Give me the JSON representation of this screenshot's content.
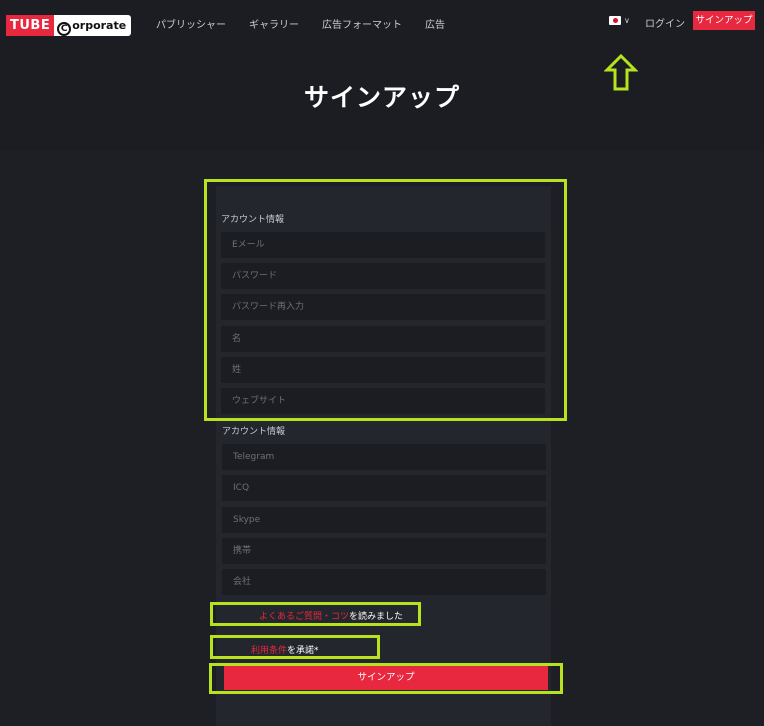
{
  "header": {
    "logo_tube": "TUBE",
    "logo_corporate": "orporate",
    "logo_c": "C",
    "nav": [
      "パブリッシャー",
      "ギャラリー",
      "広告フォーマット",
      "広告"
    ],
    "login": "ログイン",
    "signup": "サインアップ"
  },
  "page": {
    "title": "サインアップ"
  },
  "form": {
    "section1_label": "アカウント情報",
    "email_placeholder": "Eメール",
    "password_placeholder": "パスワード",
    "password_confirm_placeholder": "パスワード再入力",
    "first_name_placeholder": "名",
    "last_name_placeholder": "姓",
    "website_placeholder": "ウェブサイト",
    "section2_label": "アカウント情報",
    "telegram_placeholder": "Telegram",
    "icq_placeholder": "ICQ",
    "skype_placeholder": "Skype",
    "mobile_placeholder": "携帯",
    "company_placeholder": "会社",
    "faq_link": "よくあるご質問・コツ",
    "faq_suffix": "を読みました",
    "terms_link": "利用条件",
    "terms_suffix": "を承諾*",
    "submit": "サインアップ"
  },
  "colors": {
    "accent": "#e8283f",
    "background": "#1d1f24",
    "panel": "#23262d",
    "annotation": "#b6e31e"
  }
}
